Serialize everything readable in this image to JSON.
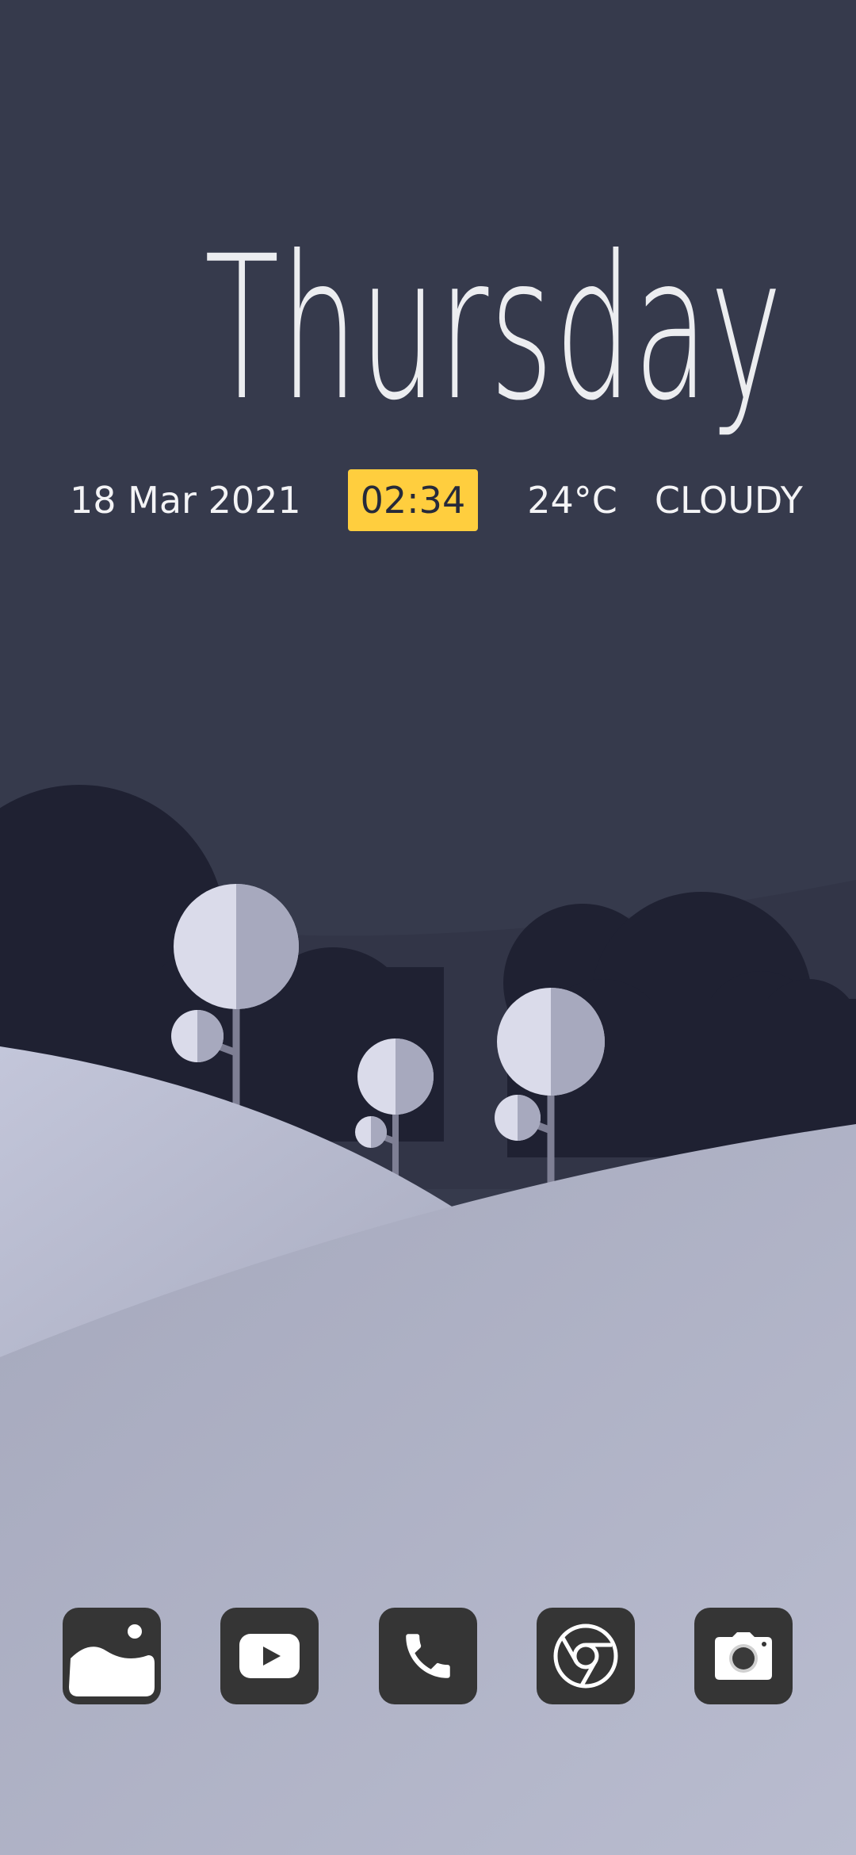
{
  "home": {
    "day": "Thursday",
    "date": "18 Mar 2021",
    "time": "02:34",
    "temperature": "24°C",
    "condition": "CLOUDY"
  },
  "dock": [
    {
      "icon": "gallery-icon",
      "label": "Gallery"
    },
    {
      "icon": "youtube-icon",
      "label": "YouTube"
    },
    {
      "icon": "phone-icon",
      "label": "Phone"
    },
    {
      "icon": "chrome-icon",
      "label": "Chrome"
    },
    {
      "icon": "camera-icon",
      "label": "Camera"
    }
  ],
  "colors": {
    "sky": "#363a4c",
    "far_hills": "#1f2132",
    "tree_crown": "#d4d6e6",
    "near_hills": "#adb0c4",
    "time_highlight": "#ffce3e",
    "icon_background": "#353535"
  }
}
